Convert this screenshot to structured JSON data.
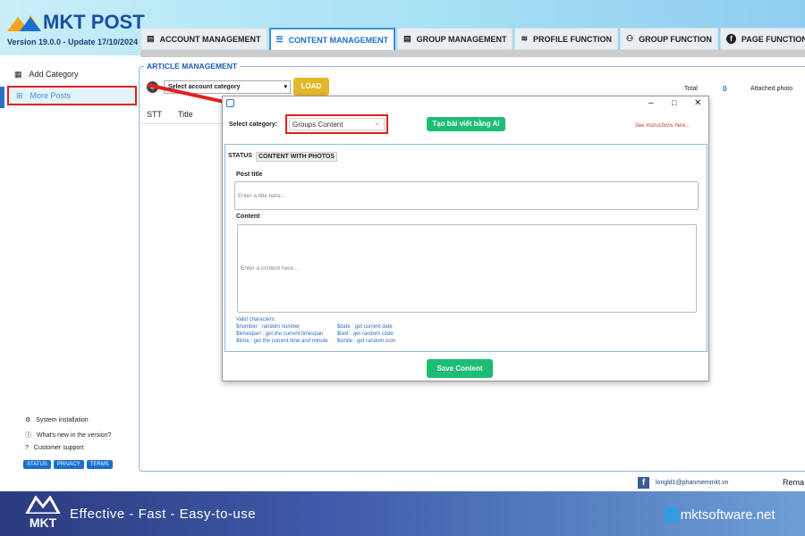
{
  "app": {
    "title": "MKT POST",
    "version": "Version  19.0.0  - Update  17/10/2024"
  },
  "tabs": [
    {
      "label": "ACCOUNT MANAGEMENT",
      "icon": "id-card-icon"
    },
    {
      "label": "CONTENT MANAGEMENT",
      "icon": "list-icon",
      "active": true
    },
    {
      "label": "GROUP MANAGEMENT",
      "icon": "document-icon"
    },
    {
      "label": "PROFILE FUNCTION",
      "icon": "signal-icon"
    },
    {
      "label": "GROUP FUNCTION",
      "icon": "group-icon"
    },
    {
      "label": "PAGE FUNCTION",
      "icon": "facebook-icon"
    }
  ],
  "sidebar": {
    "items": [
      {
        "label": "Add Category"
      },
      {
        "label": "More Posts",
        "active": true
      }
    ],
    "footer": [
      {
        "label": "System installation"
      },
      {
        "label": "What's new in the version?"
      },
      {
        "label": "Customer support"
      }
    ],
    "buttons": [
      "STATUS",
      "PRIVACY",
      "TERMS"
    ]
  },
  "main": {
    "title": "ARTICLE MANAGEMENT",
    "account_select": "Select account category",
    "load": "LOAD",
    "total_label": "Total",
    "total": "0",
    "attached": "Attached photo",
    "columns": [
      "STT",
      "Title"
    ]
  },
  "dialog": {
    "select_label": "Select category:",
    "category": "Groups Content",
    "ai_button": "Tạo bài viết bằng AI",
    "instructions": "See instructions here...",
    "tabs": [
      "STATUS",
      "CONTENT WITH PHOTOS"
    ],
    "post_title_label": "Post title",
    "post_title_placeholder": "Enter a title here...",
    "content_label": "Content",
    "content_placeholder": "Enter a content here...",
    "valid_title": "Valid characters:",
    "valid_left": [
      "$number : random number",
      "$timespan : get the current timespan",
      "$time : get the current time and minute"
    ],
    "valid_right": [
      "$date : get current date",
      "$text : get random code",
      "$smile : get random icon"
    ],
    "save": "Save Content"
  },
  "status": {
    "email": "longld1@phanmemmkt.vn",
    "remaining": "Rema"
  },
  "banner": {
    "slogan": "Effective - Fast - Easy-to-use",
    "site": "mktsoftware.net",
    "logo": "MKT"
  },
  "colors": {
    "accent": "#1a6fd0",
    "highlight": "#e02020",
    "green": "#1dbd73",
    "load": "#e2b72a"
  }
}
